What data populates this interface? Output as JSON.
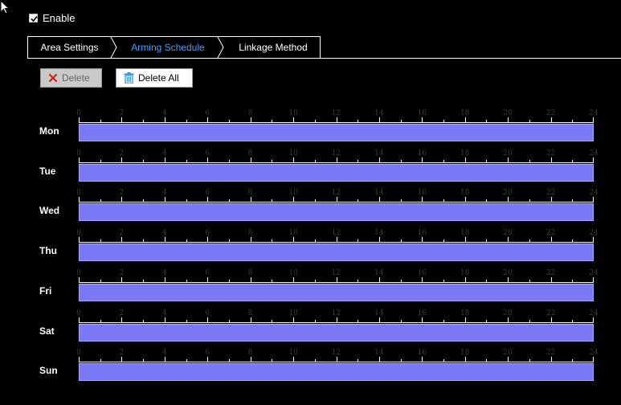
{
  "enable": {
    "label": "Enable",
    "checked": true
  },
  "tabs": [
    {
      "label": "Area Settings",
      "active": false
    },
    {
      "label": "Arming Schedule",
      "active": true
    },
    {
      "label": "Linkage Method",
      "active": false
    }
  ],
  "toolbar": {
    "delete_label": "Delete",
    "delete_all_label": "Delete All"
  },
  "hour_labels": [
    "0",
    "2",
    "4",
    "6",
    "8",
    "10",
    "12",
    "14",
    "16",
    "18",
    "20",
    "22",
    "24"
  ],
  "days": [
    {
      "label": "Mon",
      "armed_from_hour": 0,
      "armed_to_hour": 24
    },
    {
      "label": "Tue",
      "armed_from_hour": 0,
      "armed_to_hour": 24
    },
    {
      "label": "Wed",
      "armed_from_hour": 0,
      "armed_to_hour": 24
    },
    {
      "label": "Thu",
      "armed_from_hour": 0,
      "armed_to_hour": 24
    },
    {
      "label": "Fri",
      "armed_from_hour": 0,
      "armed_to_hour": 24
    },
    {
      "label": "Sat",
      "armed_from_hour": 0,
      "armed_to_hour": 24
    },
    {
      "label": "Sun",
      "armed_from_hour": 0,
      "armed_to_hour": 24
    }
  ],
  "colors": {
    "background": "#000000",
    "active_tab": "#36a3ff",
    "armed_bar": "#7b79f7",
    "delete_icon": "#d01f1f",
    "trash_icon": "#2f8fe0"
  },
  "icons": {
    "cursor": "arrow-cursor-icon",
    "delete": "x-icon",
    "delete_all": "trash-icon",
    "tab_separator": "chevron-right-icon",
    "checkbox": "checkmark-icon"
  }
}
